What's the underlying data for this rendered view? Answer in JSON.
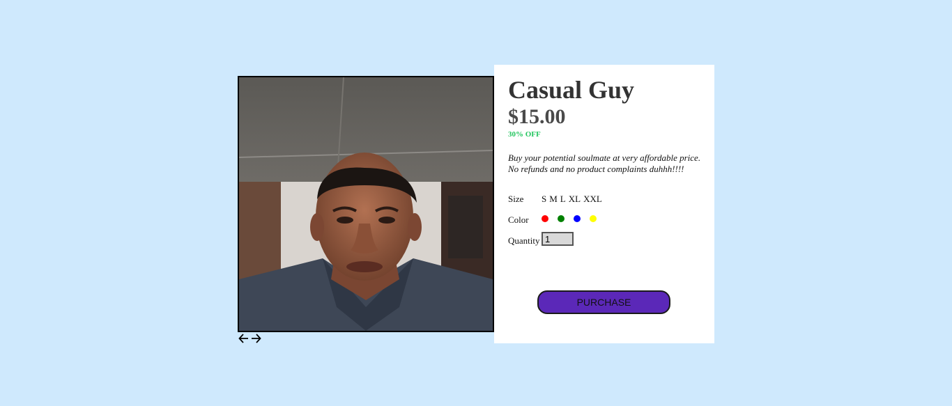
{
  "product": {
    "title": "Casual Guy",
    "price": "$15.00",
    "discount": "30% OFF",
    "description_line1": "Buy your potential soulmate at very affordable price.",
    "description_line2": "No refunds and no product complaints duhhh!!!!"
  },
  "gallery": {
    "prev_icon": "arrow-left-icon",
    "next_icon": "arrow-right-icon"
  },
  "options": {
    "size_label": "Size",
    "sizes": [
      "S",
      "M",
      "L",
      "XL",
      "XXL"
    ],
    "color_label": "Color",
    "colors": [
      "#ff0000",
      "#008000",
      "#0000ff",
      "#ffff00"
    ],
    "quantity_label": "Quantity",
    "quantity_value": "1"
  },
  "actions": {
    "purchase_label": "PURCHASE"
  }
}
